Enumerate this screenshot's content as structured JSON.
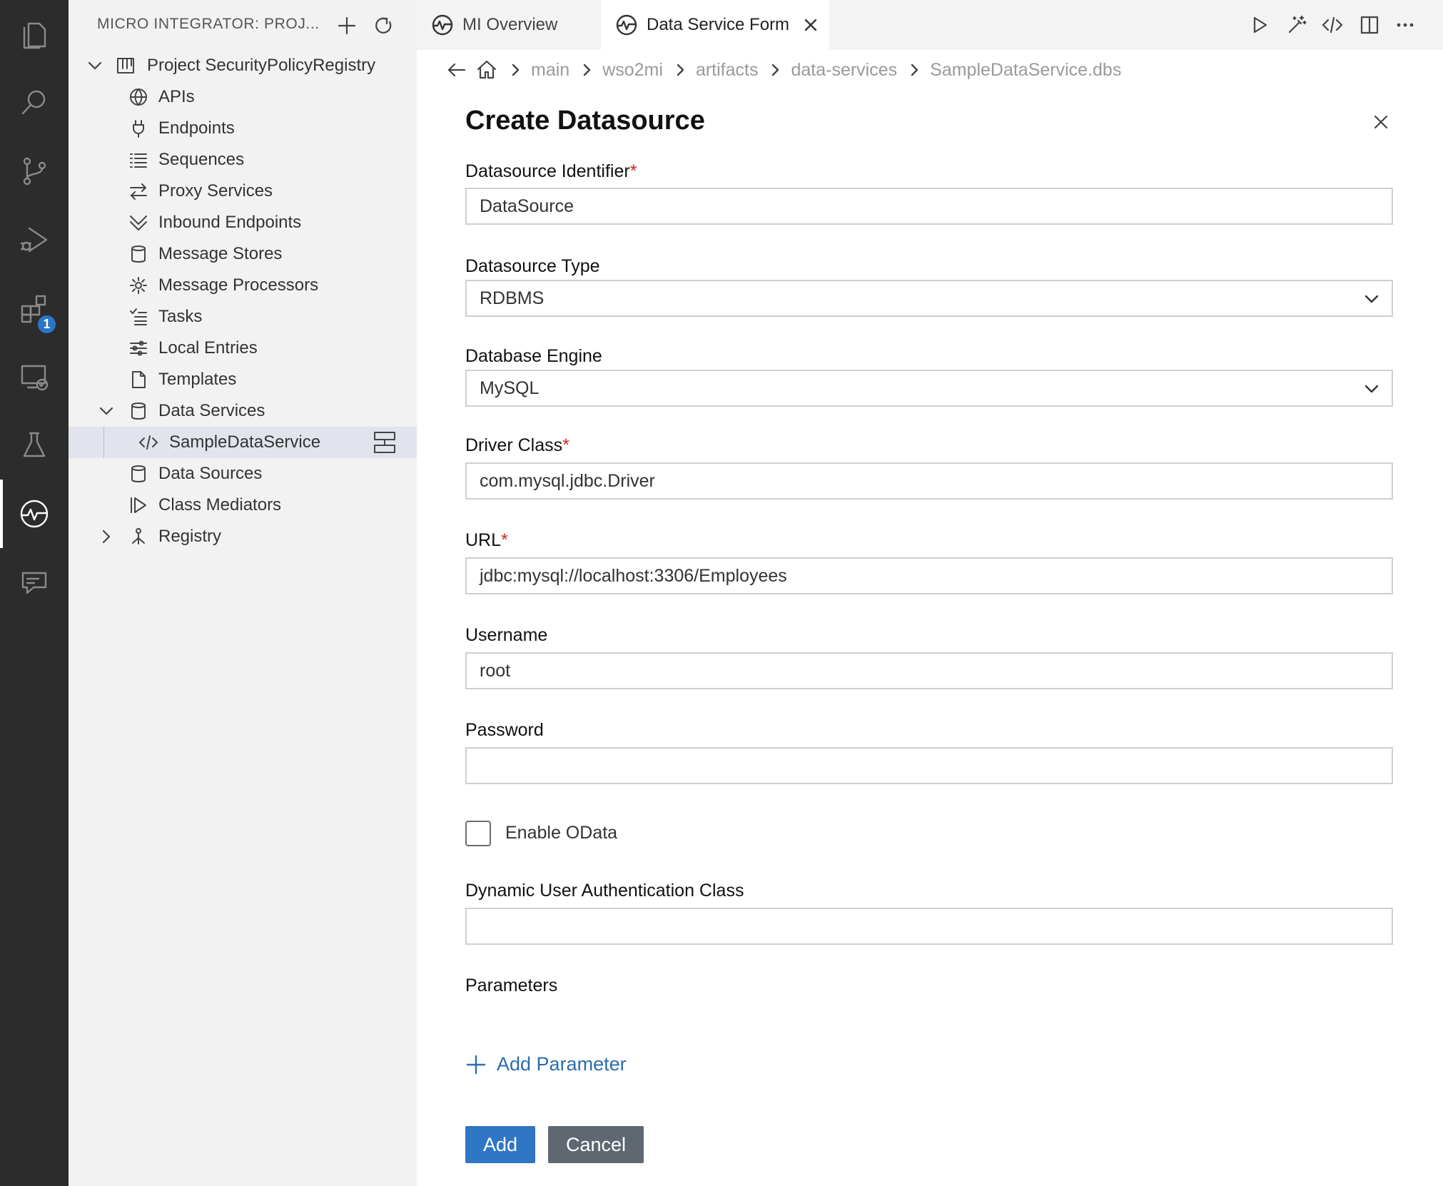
{
  "activity_bar": {
    "items": [
      "explorer-icon",
      "search-icon",
      "source-control-icon",
      "run-debug-icon",
      "extensions-icon",
      "remote-explorer-icon",
      "testing-icon",
      "micro-integrator-icon",
      "chat-icon"
    ],
    "extensions_badge": "1"
  },
  "sidebar": {
    "title": "MICRO INTEGRATOR: PROJ...",
    "project": "Project SecurityPolicyRegistry",
    "items": [
      {
        "label": "APIs",
        "icon": "globe-icon"
      },
      {
        "label": "Endpoints",
        "icon": "plug-icon"
      },
      {
        "label": "Sequences",
        "icon": "list-icon"
      },
      {
        "label": "Proxy Services",
        "icon": "arrows-swap-icon"
      },
      {
        "label": "Inbound Endpoints",
        "icon": "inbound-icon"
      },
      {
        "label": "Message Stores",
        "icon": "database-icon"
      },
      {
        "label": "Message Processors",
        "icon": "gear-icon"
      },
      {
        "label": "Tasks",
        "icon": "tasks-icon"
      },
      {
        "label": "Local Entries",
        "icon": "sliders-icon"
      },
      {
        "label": "Templates",
        "icon": "file-icon"
      },
      {
        "label": "Data Services",
        "icon": "database-icon"
      },
      {
        "label": "SampleDataService",
        "icon": "code-icon"
      },
      {
        "label": "Data Sources",
        "icon": "database-icon"
      },
      {
        "label": "Class Mediators",
        "icon": "class-mediator-icon"
      },
      {
        "label": "Registry",
        "icon": "registry-icon"
      }
    ]
  },
  "tabs": [
    {
      "label": "MI Overview",
      "active": false
    },
    {
      "label": "Data Service Form",
      "active": true
    }
  ],
  "breadcrumb": [
    "main",
    "wso2mi",
    "artifacts",
    "data-services",
    "SampleDataService.dbs"
  ],
  "form": {
    "title": "Create Datasource",
    "required_mark": "*",
    "fields": {
      "identifier": {
        "label": "Datasource Identifier",
        "value": "DataSource"
      },
      "type": {
        "label": "Datasource Type",
        "value": "RDBMS"
      },
      "engine": {
        "label": "Database Engine",
        "value": "MySQL"
      },
      "driver": {
        "label": "Driver Class",
        "value": "com.mysql.jdbc.Driver"
      },
      "url": {
        "label": "URL",
        "value": "jdbc:mysql://localhost:3306/Employees"
      },
      "username": {
        "label": "Username",
        "value": "root"
      },
      "password": {
        "label": "Password",
        "value": ""
      },
      "odata": {
        "label": "Enable OData",
        "checked": false
      },
      "auth_class": {
        "label": "Dynamic User Authentication Class",
        "value": ""
      }
    },
    "parameters_label": "Parameters",
    "add_parameter": "Add Parameter",
    "add_button": "Add",
    "cancel_button": "Cancel"
  },
  "colors": {
    "activity_bar": "#2c2c2c",
    "sidebar": "#f2f2f2",
    "accent": "#2f76c5",
    "link": "#2b6cb0",
    "cancel": "#5f6871",
    "required": "#c62828"
  }
}
